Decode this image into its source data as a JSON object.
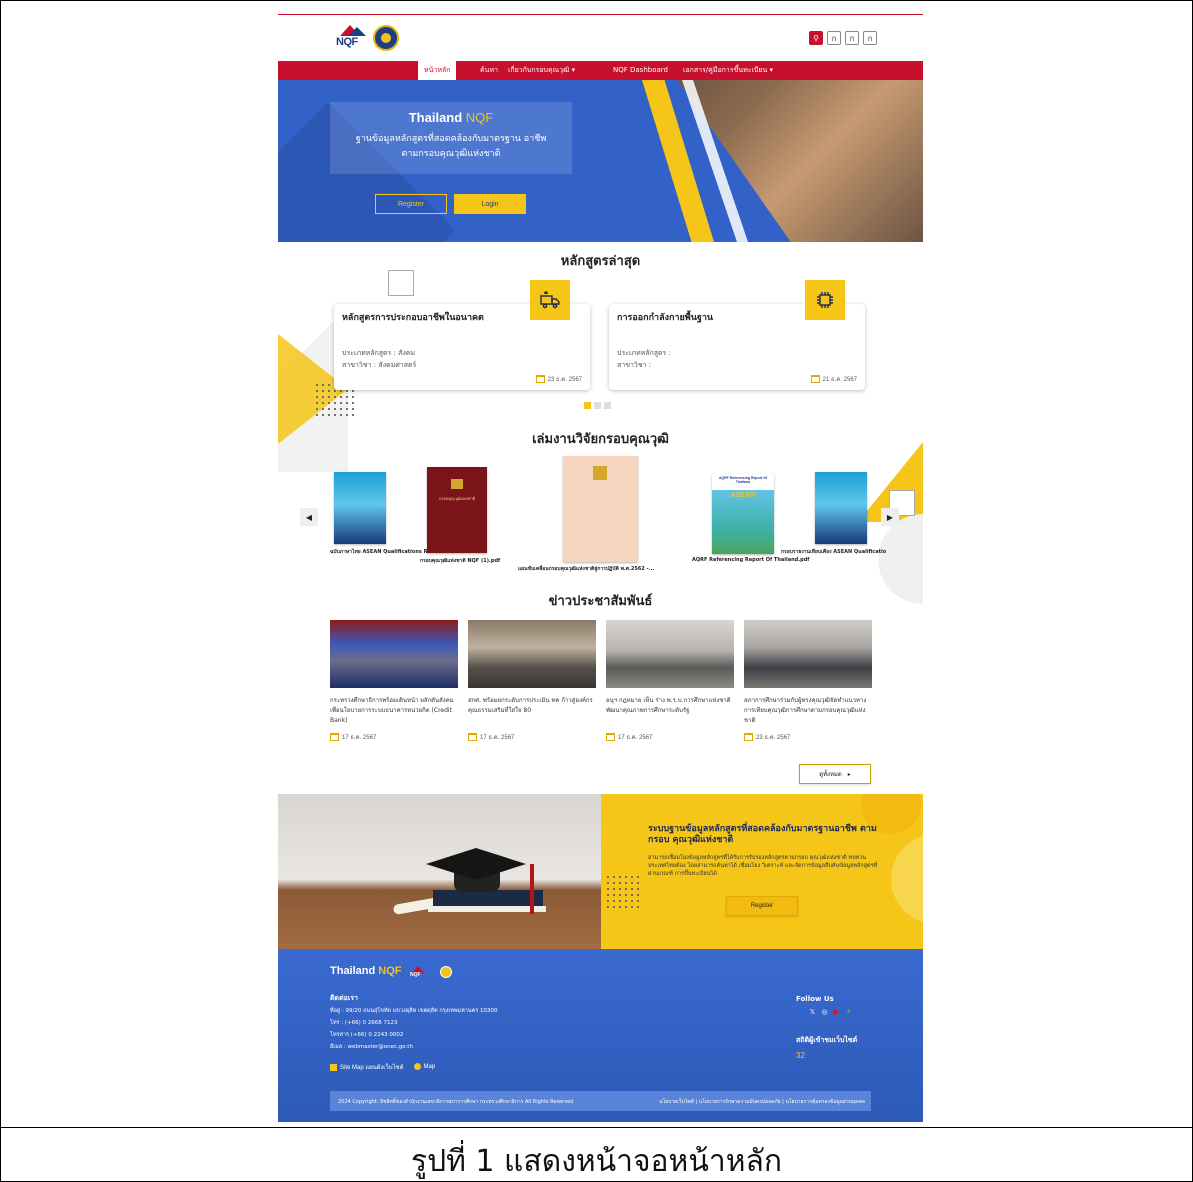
{
  "header": {
    "logo_nqf_text": "NQF",
    "icons": [
      "search-icon",
      "font-size-icon",
      "font-size-icon",
      "font-size-icon"
    ],
    "icon_glyphs": [
      "⚲",
      "ก",
      "ก",
      "ก"
    ]
  },
  "nav": {
    "items": [
      {
        "label": "หน้าหลัก"
      },
      {
        "label": "ค้นหา"
      },
      {
        "label": "เกี่ยวกับกรอบคุณวุฒิ  ▾"
      },
      {
        "label": "NQF Dashboard"
      },
      {
        "label": "เอกสาร/คู่มือการขึ้นทะเบียน  ▾"
      }
    ]
  },
  "hero": {
    "title_prefix": "Thailand ",
    "title_nqf": "NQF",
    "subtitle_line1": "ฐานข้อมูลหลักสูตรที่สอดคล้องกับมาตรฐาน อาชีพ",
    "subtitle_line2": "ตามกรอบคุณวุฒิแห่งชาติ",
    "register_label": "Register",
    "login_label": "Login"
  },
  "latest": {
    "title": "หลักสูตรล่าสุด",
    "cards": [
      {
        "title": "หลักสูตรการประกอบอาชีพในอนาคต",
        "type": "ประเภทหลักสูตร : สังคม",
        "field": "สาขาวิชา : สังคมศาสตร์",
        "date": "23 ธ.ค. 2567"
      },
      {
        "title": "การออกกำลังกายพื้นฐาน",
        "type": "ประเภทหลักสูตร :",
        "field": "สาขาวิชา :",
        "date": "21 ธ.ค. 2567"
      }
    ]
  },
  "research": {
    "title": "เล่มงานวิจัยกรอบคุณวุฒิ",
    "books": [
      {
        "label": "ฉบับภาษาไทย ASEAN Qualifications Reference..."
      },
      {
        "label": "กรอบคุณวุฒิแห่งชาติ NQF (1).pdf"
      },
      {
        "label": "แผนขับเคลื่อนกรอบคุณวุฒิแห่งชาติสู่การปฏิบัติ พ.ศ.2562 -..."
      },
      {
        "label": "AQRF Referencing Report Of Thailand.pdf"
      },
      {
        "label": "กรอบรายงานเทียบเคียง ASEAN Qualificatio"
      }
    ],
    "cover_texts": {
      "asean_title": "AQRF Referencing Report Of Thailand",
      "asean_word": "ASEAN",
      "red_book_title": "กรอบคุณวุฒิแห่งชาติ"
    }
  },
  "news": {
    "title": "ข่าวประชาสัมพันธ์",
    "items": [
      {
        "text": "กระทรวงศึกษาธิการพร้อมเดินหน้า ผลักดันสังคมเพื่อนโยบายการระบบธนาคารหน่วยกิต (Credit Bank)",
        "date": "17 ธ.ค. 2567"
      },
      {
        "text": "สกศ. พร้อมยกระดับการประเมิน ทค ก้าวสู่องค์กรคุณธรรมเสริมที่ใส่ใจ 80",
        "date": "17 ธ.ค. 2567"
      },
      {
        "text": "อนุฯ กฎหมาย เห็น ร่าง พ.ร.บ.การศึกษาแห่งชาติ พัฒนาคุณภาพการศึกษาระดับรัฐ",
        "date": "17 ธ.ค. 2567"
      },
      {
        "text": "สภาการศึกษาร่วมกับผู้ทรงคุณวุฒิจัดทำแนวทางการเทียบคุณวุฒิการศึกษาตามกรอบคุณวุฒิแห่งชาติ",
        "date": "23 ธ.ค. 2567"
      }
    ],
    "view_all_label": "ดูทั้งหมด"
  },
  "promo": {
    "title": "ระบบฐานข้อมูลหลักสูตรที่สอดคล้องกับมาตรฐานอาชีพ ตาม กรอบ คุณวุฒิแห่งชาติ",
    "description": "สามารถเชื่อมโยงข้อมูลหลักสูตรที่ได้รับการรับรองหลักสูตรตามกรอบ คุณวุฒิแห่งชาติ ทบทวนประเทศไทยต้อง โดยสามารถค้นหาได้ เชื่อมโยง วิเคราะห์ และจัดการข้อมูลสืบค้นข้อมูลหลักสูตรที่ผ่านเกณฑ์ การขึ้นทะเบียนได้",
    "register_label": "Register"
  },
  "footer": {
    "brand_prefix": "Thailand ",
    "brand_nqf": "NQF",
    "logo_text": "NQF",
    "contact_heading": "ติดต่อเรา",
    "address": "ที่อยู่ : 99/20 ถนนสุโขทัย แขวงดุสิต เขตดุสิต กรุงเทพมหานคร 10300",
    "phone": "โทร : (+66) 0 2668 7123",
    "fax": "โทรสาร (+66) 0 2243 0002",
    "email": "อีเมล : webmaster@onec.go.th",
    "sitemap_label": "Site Map แผนผังเว็บไซต์",
    "map_label": "Map",
    "follow_heading": "Follow Us",
    "social_icons": [
      "facebook-icon",
      "x-icon",
      "instagram-icon",
      "youtube-icon",
      "tiktok-icon"
    ],
    "social_glyphs": [
      "f",
      "𝕏",
      "◎",
      "▶",
      "♪"
    ],
    "social_colors": [
      "#1877f2",
      "#ffffff",
      "#ffffff",
      "#ff0000",
      "#f5c518"
    ],
    "stats_heading": "สถิติผู้เข้าชมเว็บไซต์",
    "visitor_count": "32",
    "copyright": "2024 Copyright: ลิขสิทธิ์ของสำนักงานเลขาธิการสภาการศึกษา กระทรวงศึกษาธิการ All Rights Reserved",
    "policy_links": "นโยบายเว็บไซต์ | นโยบายการรักษาความมั่นคงปลอดภัย | นโยบายการคุ้มครองข้อมูลส่วนบุคคล"
  },
  "caption": "รูปที่ 1 แสดงหน้าจอหน้าหลัก",
  "colors": {
    "brand_red": "#c8102e",
    "brand_blue": "#3262c7",
    "brand_yellow": "#f5c518"
  }
}
